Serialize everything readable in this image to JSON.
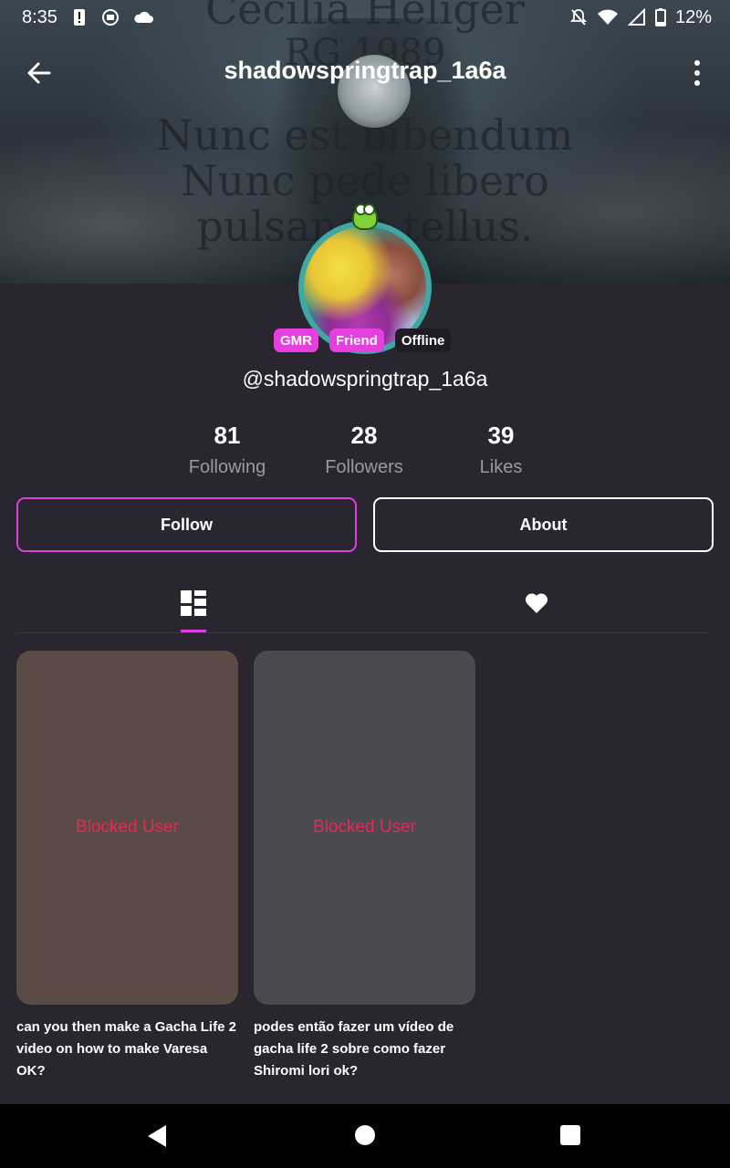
{
  "status_bar": {
    "time": "8:35",
    "battery": "12%",
    "icons": [
      "alert-icon",
      "cast-icon",
      "cloud-icon",
      "notifications-off-icon",
      "wifi-icon",
      "signal-icon",
      "battery-icon"
    ]
  },
  "banner": {
    "lines": [
      "Cecilia Heliger",
      "RG 1989",
      "Nunc est bibendum",
      "Nunc pede libero",
      "pulsanda tellus."
    ]
  },
  "header": {
    "title": "shadowspringtrap_1a6a"
  },
  "profile": {
    "badges": [
      "GMR",
      "Friend",
      "Offline"
    ],
    "handle": "@shadowspringtrap_1a6a",
    "stats": [
      {
        "value": "81",
        "label": "Following"
      },
      {
        "value": "28",
        "label": "Followers"
      },
      {
        "value": "39",
        "label": "Likes"
      }
    ]
  },
  "actions": {
    "follow_label": "Follow",
    "about_label": "About"
  },
  "tabs": [
    "grid-icon",
    "heart-icon"
  ],
  "posts": [
    {
      "overlay": "Blocked User",
      "caption": "can you then make a Gacha Life 2 video on how to make Varesa OK?"
    },
    {
      "overlay": "Blocked User",
      "caption": "podes então fazer um vídeo de gacha life 2 sobre como fazer Shiromi lori ok?"
    }
  ],
  "colors": {
    "accent": "#e03fe0",
    "background": "#2a2630",
    "blocked_text": "#e4285a"
  }
}
